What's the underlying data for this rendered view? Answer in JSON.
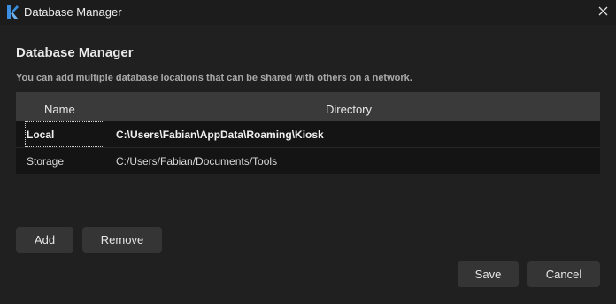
{
  "window": {
    "title": "Database Manager",
    "icon": "kiosk-logo-icon",
    "accent_color": "#3c8fe0"
  },
  "dialog": {
    "heading": "Database Manager",
    "description": "You can add multiple database locations that can be shared with others on a network."
  },
  "table": {
    "columns": [
      "Name",
      "Directory"
    ],
    "rows": [
      {
        "name": "Local",
        "directory": "C:\\Users\\Fabian\\AppData\\Roaming\\Kiosk",
        "selected": true
      },
      {
        "name": "Storage",
        "directory": "C:/Users/Fabian/Documents/Tools",
        "selected": false
      }
    ]
  },
  "buttons": {
    "add": "Add",
    "remove": "Remove",
    "save": "Save",
    "cancel": "Cancel"
  }
}
